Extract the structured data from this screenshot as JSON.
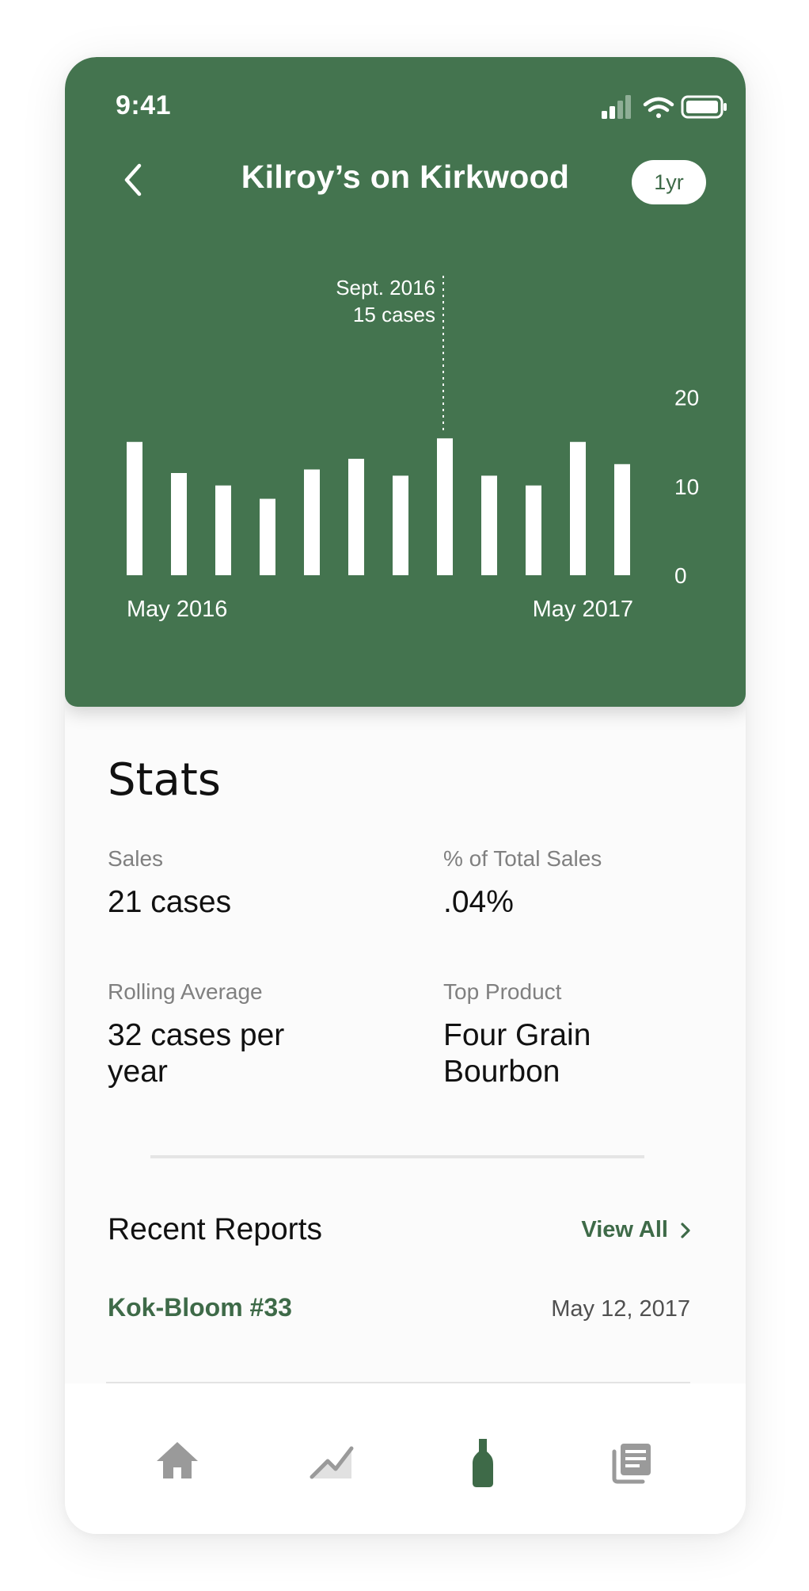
{
  "status_bar": {
    "time": "9:41"
  },
  "header": {
    "title": "Kilroy’s on Kirkwood",
    "range_label": "1yr"
  },
  "chart_data": {
    "type": "bar",
    "title": "",
    "xlabel": "",
    "ylabel": "",
    "ylim": [
      0,
      23
    ],
    "yticks": [
      0,
      10,
      20
    ],
    "x_start_label": "May 2016",
    "x_end_label": "May 2017",
    "series": [
      {
        "values": [
          15,
          11.5,
          10.1,
          8.6,
          11.9,
          13.1,
          11.2,
          15.4,
          11.2,
          10.1,
          15,
          12.5
        ]
      }
    ],
    "highlight": {
      "index": 7,
      "month_label": "Sept. 2016",
      "value_label": "15 cases"
    },
    "bar_color": "#ffffff"
  },
  "stats": {
    "title": "Stats",
    "items": [
      {
        "label": "Sales",
        "value": "21 cases"
      },
      {
        "label": "% of Total Sales",
        "value": ".04%"
      },
      {
        "label": "Rolling Average",
        "value": "32 cases per year"
      },
      {
        "label": "Top Product",
        "value": "Four Grain Bourbon"
      }
    ]
  },
  "reports": {
    "title": "Recent Reports",
    "view_all_label": "View All",
    "items": [
      {
        "name": "Kok-Bloom #33",
        "date": "May 12, 2017"
      }
    ]
  },
  "tabbar": {
    "items": [
      {
        "icon": "home-icon",
        "active": false
      },
      {
        "icon": "trend-chart-icon",
        "active": false
      },
      {
        "icon": "bottle-icon",
        "active": true
      },
      {
        "icon": "reports-icon",
        "active": false
      }
    ]
  },
  "colors": {
    "brand_green": "#44744f",
    "accent_green": "#3e6a48",
    "inactive_icon": "#9a9a9a"
  }
}
